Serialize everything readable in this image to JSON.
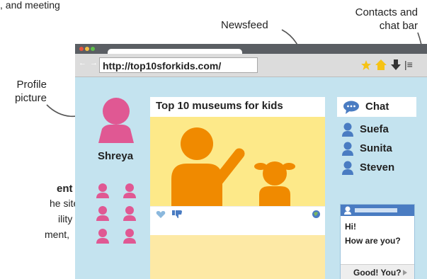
{
  "callouts": {
    "newsfeed": "Newsfeed",
    "contacts_line1": "Contacts and",
    "contacts_line2": "chat bar",
    "profile_line1": "Profile",
    "profile_line2": "picture"
  },
  "cropped_text": {
    "top_line": ", and meeting",
    "heading_fragment": "ent",
    "line1": "he site",
    "line2": "ility",
    "line3": "ment,"
  },
  "browser": {
    "nav_glyphs": "← → C",
    "url": "http://top10sforkids.com/",
    "menu_glyph": "|≡"
  },
  "profile": {
    "name": "Shreya"
  },
  "newsfeed": {
    "post_title": "Top 10 museums for kids"
  },
  "chat": {
    "title": "Chat",
    "contacts": [
      "Suefa",
      "Sunita",
      "Steven"
    ],
    "messages": [
      "Hi!",
      "How are you?"
    ],
    "reply": "Good! You?"
  },
  "colors": {
    "page_bg": "#c4e3ef",
    "pink": "#e05893",
    "orange": "#f08a00",
    "yellow": "#fde989",
    "blue": "#4a7cc2"
  }
}
